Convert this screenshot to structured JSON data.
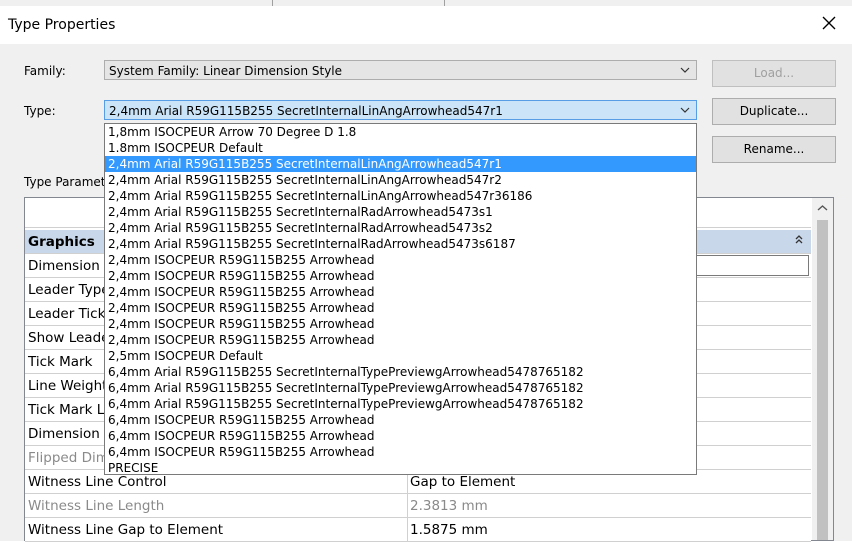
{
  "window": {
    "title": "Type Properties"
  },
  "family": {
    "label": "Family:",
    "value": "System Family: Linear Dimension Style"
  },
  "type": {
    "label": "Type:",
    "value": "2,4mm Arial R59G115B255 SecretInternalLinAngArrowhead547r1",
    "selected_index": 2,
    "options": [
      "1,8mm ISOCPEUR Arrow 70 Degree D 1.8",
      "1.8mm ISOCPEUR Default",
      "2,4mm Arial R59G115B255 SecretInternalLinAngArrowhead547r1",
      "2,4mm Arial R59G115B255 SecretInternalLinAngArrowhead547r2",
      "2,4mm Arial R59G115B255 SecretInternalLinAngArrowhead547r36186",
      "2,4mm Arial R59G115B255 SecretInternalRadArrowhead5473s1",
      "2,4mm Arial R59G115B255 SecretInternalRadArrowhead5473s2",
      "2,4mm Arial R59G115B255 SecretInternalRadArrowhead5473s6187",
      "2,4mm ISOCPEUR R59G115B255 Arrowhead",
      "2,4mm ISOCPEUR R59G115B255 Arrowhead",
      "2,4mm ISOCPEUR R59G115B255 Arrowhead",
      "2,4mm ISOCPEUR R59G115B255 Arrowhead",
      "2,4mm ISOCPEUR R59G115B255 Arrowhead",
      "2,4mm ISOCPEUR R59G115B255 Arrowhead",
      "2,5mm ISOCPEUR Default",
      "6,4mm Arial R59G115B255 SecretInternalTypePreviewgArrowhead5478765182",
      "6,4mm Arial R59G115B255 SecretInternalTypePreviewgArrowhead5478765182",
      "6,4mm Arial R59G115B255 SecretInternalTypePreviewgArrowhead5478765182",
      "6,4mm ISOCPEUR R59G115B255 Arrowhead",
      "6,4mm ISOCPEUR R59G115B255 Arrowhead",
      "6,4mm ISOCPEUR R59G115B255 Arrowhead",
      "PRECISE"
    ]
  },
  "buttons": {
    "load": "Load...",
    "duplicate": "Duplicate...",
    "rename": "Rename..."
  },
  "type_parameters_label": "Type Paramet",
  "grid": {
    "group_label": "Graphics",
    "rows": [
      {
        "name": "Dimension",
        "value": "",
        "muted": false
      },
      {
        "name": "Leader Type",
        "value": "",
        "muted": false
      },
      {
        "name": "Leader Tick",
        "value": "",
        "muted": false
      },
      {
        "name": "Show Leade",
        "value": "",
        "muted": false
      },
      {
        "name": "Tick Mark",
        "value": "",
        "muted": false
      },
      {
        "name": "Line Weight",
        "value": "",
        "muted": false
      },
      {
        "name": "Tick Mark L",
        "value": "",
        "muted": false
      },
      {
        "name": "Dimension",
        "value": "",
        "muted": false
      },
      {
        "name": "Flipped Dim",
        "value": "",
        "muted": true
      },
      {
        "name": "Witness Line Control",
        "value": "Gap to Element",
        "muted": false
      },
      {
        "name": "Witness Line Length",
        "value": "2.3813 mm",
        "muted": true
      },
      {
        "name": "Witness Line Gap to Element",
        "value": "1.5875 mm",
        "muted": false
      }
    ]
  },
  "colors": {
    "selection": "#3399ff",
    "group_header": "#c8d8ea"
  }
}
